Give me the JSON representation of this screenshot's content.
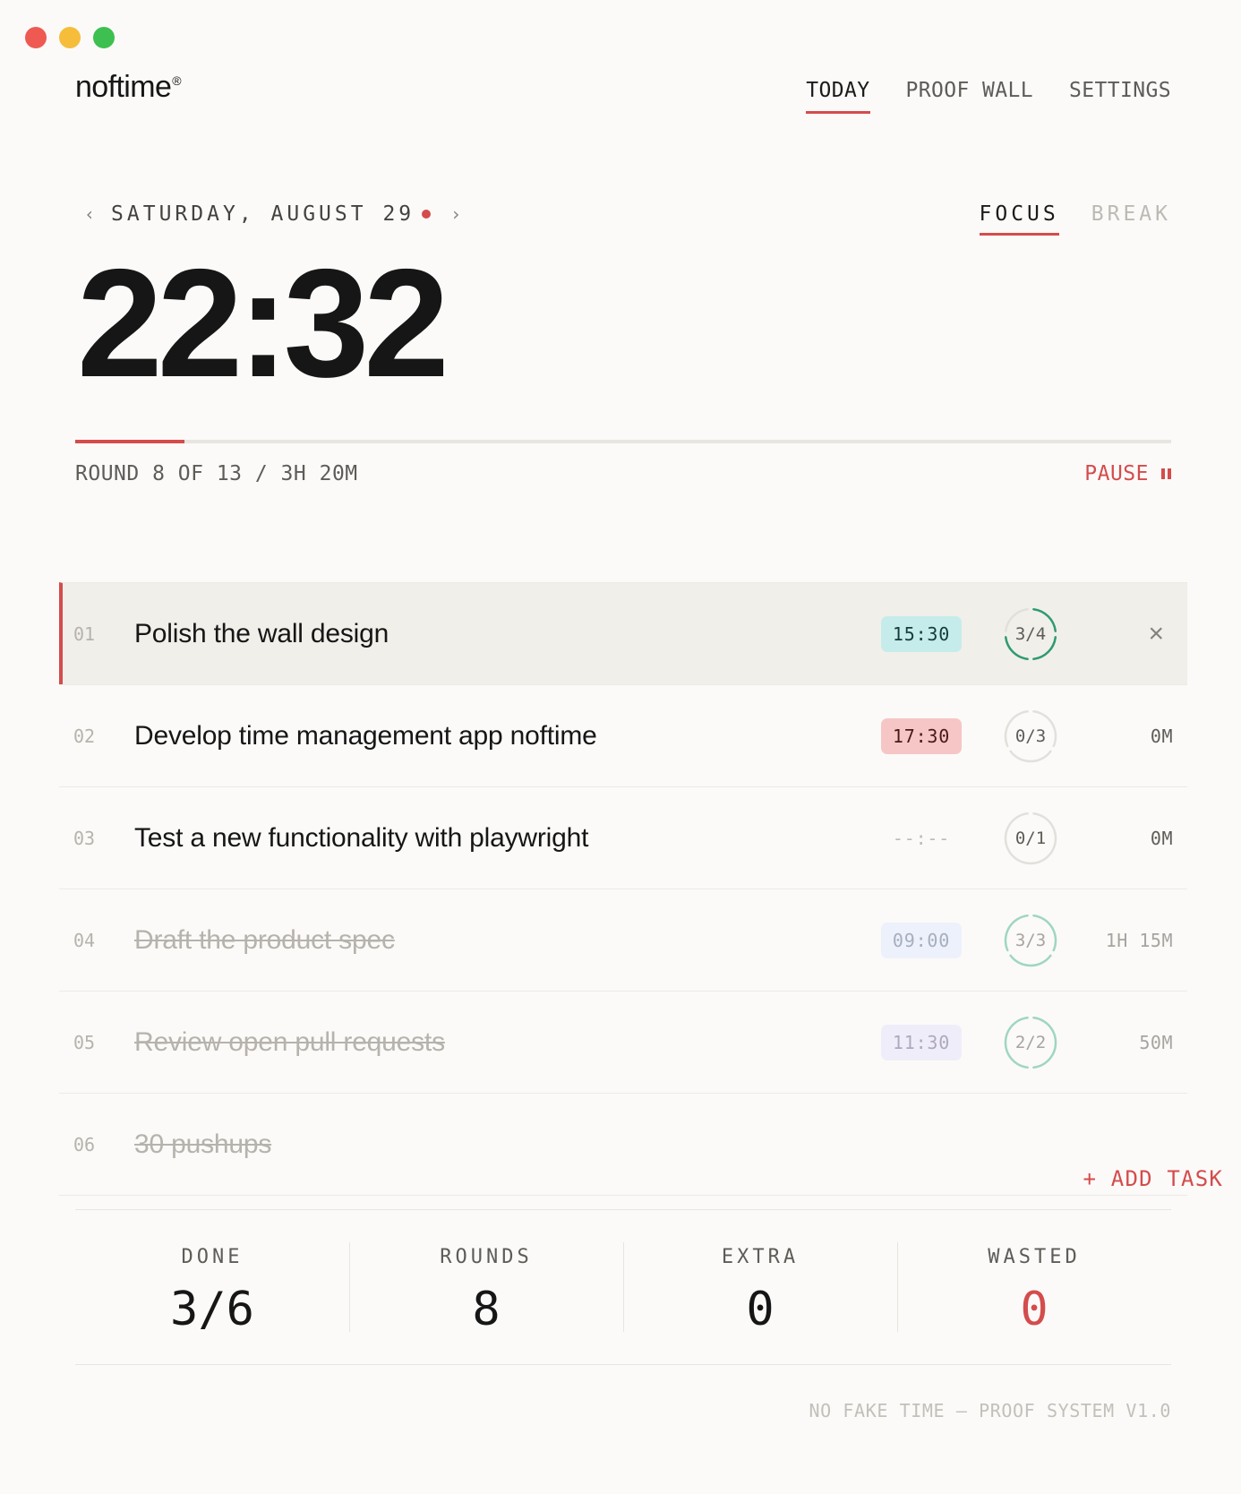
{
  "app": {
    "logo": "noftime",
    "logo_mark": "®"
  },
  "nav": [
    {
      "label": "TODAY",
      "active": true
    },
    {
      "label": "PROOF WALL",
      "active": false
    },
    {
      "label": "SETTINGS",
      "active": false
    }
  ],
  "date": {
    "prev": "‹",
    "label": "SATURDAY, AUGUST 29",
    "next": "›"
  },
  "modes": [
    {
      "label": "FOCUS",
      "active": true
    },
    {
      "label": "BREAK",
      "active": false
    }
  ],
  "timer": {
    "display": "22:32",
    "progress": 0.1
  },
  "round_info": "ROUND 8 OF 13 / 3H 20M",
  "pause_label": "PAUSE",
  "tasks": [
    {
      "num": "01",
      "title": "Polish the wall design",
      "time": "15:30",
      "badge": "teal",
      "rounds_done": 3,
      "rounds_total": 4,
      "rounds_label": "3/4",
      "spent": "",
      "done": false,
      "active": true
    },
    {
      "num": "02",
      "title": "Develop time management app noftime",
      "time": "17:30",
      "badge": "red",
      "rounds_done": 0,
      "rounds_total": 3,
      "rounds_label": "0/3",
      "spent": "0M",
      "done": false,
      "active": false
    },
    {
      "num": "03",
      "title": "Test a new functionality with playwright",
      "time": "--:--",
      "badge": "none",
      "rounds_done": 0,
      "rounds_total": 1,
      "rounds_label": "0/1",
      "spent": "0M",
      "done": false,
      "active": false
    },
    {
      "num": "04",
      "title": "Draft the product spec",
      "time": "09:00",
      "badge": "blue",
      "rounds_done": 3,
      "rounds_total": 3,
      "rounds_label": "3/3",
      "spent": "1H 15M",
      "done": true,
      "active": false
    },
    {
      "num": "05",
      "title": "Review open pull requests",
      "time": "11:30",
      "badge": "purple",
      "rounds_done": 2,
      "rounds_total": 2,
      "rounds_label": "2/2",
      "spent": "50M",
      "done": true,
      "active": false
    },
    {
      "num": "06",
      "title": "30 pushups",
      "time": "",
      "badge": "",
      "rounds_done": 0,
      "rounds_total": 0,
      "rounds_label": "",
      "spent": "",
      "done": true,
      "active": false
    }
  ],
  "close_icon": "×",
  "add_task_label": "+ ADD TASK",
  "stats": [
    {
      "label": "DONE",
      "value": "3/6",
      "accent": false
    },
    {
      "label": "ROUNDS",
      "value": "8",
      "accent": false
    },
    {
      "label": "EXTRA",
      "value": "0",
      "accent": false
    },
    {
      "label": "WASTED",
      "value": "0",
      "accent": true
    }
  ],
  "footer": "NO FAKE TIME — PROOF SYSTEM V1.0",
  "colors": {
    "accent": "#d44c4c",
    "ring_active": "#2e9a72",
    "ring_done": "#9fd6c1",
    "ring_empty": "#e2e0dc"
  }
}
